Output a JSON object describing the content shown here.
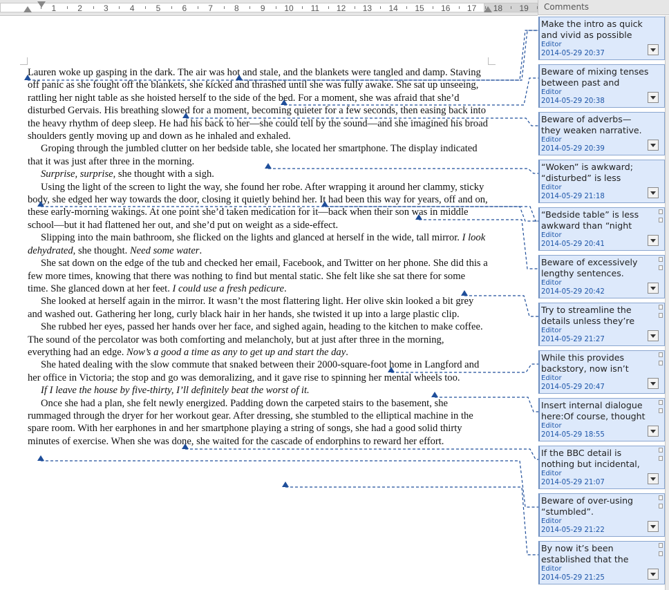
{
  "ruler": {
    "numbers": [
      "1",
      "2",
      "3",
      "4",
      "5",
      "6",
      "7",
      "8",
      "9",
      "10",
      "11",
      "12",
      "13",
      "14",
      "15",
      "16",
      "17",
      "18",
      "19"
    ]
  },
  "comments_panel": {
    "title": "Comments"
  },
  "document": {
    "paragraphs": [
      {
        "indent": false,
        "parts": [
          {
            "t": "Lauren woke up gasping in the dark. The air was hot and stale, and the blankets were tangled and damp. Staving off panic as she fought off the blankets, she kicked and thrashed until she was fully awake. She sat up unseeing, rattling her night table as she hoisted herself to the side of the bed. For a moment, she was afraid that she’d disturbed Gervais. His breathing slowed for a moment, becoming quieter for a few seconds, then easing back into the heavy rhythm of deep sleep. He had his back to her—she could tell by the sound—and she imagined his broad shoulders gently moving up and down as he inhaled and exhaled."
          }
        ]
      },
      {
        "indent": true,
        "parts": [
          {
            "t": "Groping through the jumbled clutter on her bedside table, she located her smartphone. The display indicated that it was just after three in the morning."
          }
        ]
      },
      {
        "indent": true,
        "parts": [
          {
            "t": "Surprise, surprise",
            "i": true
          },
          {
            "t": ", she thought with a sigh."
          }
        ]
      },
      {
        "indent": true,
        "parts": [
          {
            "t": "Using the light of the screen to light the way, she found her robe. After wrapping it around her clammy, sticky body, she edged her way towards the door, closing it quietly behind her. It had been this way for years, off and on, these early-morning wakings. At one point she’d taken medication for it—back when their son was in middle school—but it had flattened her out, and she’d put on weight as a side-effect."
          }
        ]
      },
      {
        "indent": true,
        "parts": [
          {
            "t": "Slipping into the main bathroom, she flicked on the lights and glanced at herself in the wide, tall mirror. "
          },
          {
            "t": "I look dehydrated",
            "i": true
          },
          {
            "t": ", she thought. "
          },
          {
            "t": "Need some water",
            "i": true
          },
          {
            "t": "."
          }
        ]
      },
      {
        "indent": true,
        "parts": [
          {
            "t": "She sat down on the edge of the tub and checked her email, Facebook, and Twitter on her phone. She did this a few more times, knowing that there was nothing to find but mental static. She felt like she sat there for some time. She glanced down at her feet. "
          },
          {
            "t": "I could use a fresh pedicure",
            "i": true
          },
          {
            "t": "."
          }
        ]
      },
      {
        "indent": true,
        "parts": [
          {
            "t": "She looked at herself again in the mirror. It wasn’t the most flattering light. Her olive skin looked a bit grey and washed out. Gathering her long, curly black hair in her hands, she twisted it up into a large plastic clip."
          }
        ]
      },
      {
        "indent": true,
        "parts": [
          {
            "t": "She rubbed her eyes, passed her hands over her face, and sighed again, heading to the kitchen to make coffee. The sound of the percolator was both comforting and melancholy, but at just after three in the morning, everything had an edge. "
          },
          {
            "t": "Now’s a good a time as any to get up and start the day",
            "i": true
          },
          {
            "t": "."
          }
        ]
      },
      {
        "indent": true,
        "parts": [
          {
            "t": "She hated dealing with the slow commute that snaked between their 2000-square-foot home in Langford and her office in Victoria; the stop and go was demoralizing, and it gave rise to spinning her mental wheels too."
          }
        ]
      },
      {
        "indent": true,
        "parts": [
          {
            "t": "If I leave the house by five-thirty, I’ll definitely beat the worst of it.",
            "i": true
          }
        ]
      },
      {
        "indent": true,
        "parts": [
          {
            "t": "Once she had a plan, she felt newly energized. Padding down the carpeted stairs to the basement, she rummaged through the dryer for her workout gear. After dressing, she stumbled to the elliptical machine in the spare room. With her earphones in and her smartphone playing a string of songs, she had a good solid thirty minutes of exercise. When she was done, she waited for the cascade of endorphins to reward her effort."
          }
        ]
      }
    ]
  },
  "comments": [
    {
      "text": "Make the intro as quick and vivid as possible without",
      "author": "Editor",
      "date": "2014-05-29 20:37"
    },
    {
      "text": "Beware of mixing tenses between past and present.",
      "author": "Editor",
      "date": "2014-05-29 20:38"
    },
    {
      "text": "Beware of adverbs—they weaken narrative.",
      "author": "Editor",
      "date": "2014-05-29 20:39"
    },
    {
      "text": "“Woken” is awkward; “disturbed” is less",
      "author": "Editor",
      "date": "2014-05-29 21:18"
    },
    {
      "text": "“Bedside table” is less awkward than “night",
      "author": "Editor",
      "date": "2014-05-29 20:41"
    },
    {
      "text": "Beware of excessively lengthy sentences.",
      "author": "Editor",
      "date": "2014-05-29 20:42"
    },
    {
      "text": "Try to streamline the details unless they’re",
      "author": "Editor",
      "date": "2014-05-29 21:27"
    },
    {
      "text": "While this provides backstory, now isn’t",
      "author": "Editor",
      "date": "2014-05-29 20:47"
    },
    {
      "text": "Insert internal dialogue here:Of course, thought",
      "author": "Editor",
      "date": "2014-05-29 18:55"
    },
    {
      "text": "If the BBC detail is nothing but incidental,",
      "author": "Editor",
      "date": "2014-05-29 21:07"
    },
    {
      "text": "Beware of over-using “stumbled”.",
      "author": "Editor",
      "date": "2014-05-29 21:22"
    },
    {
      "text": "By now it’s been established that the",
      "author": "Editor",
      "date": "2014-05-29 21:25"
    }
  ],
  "colors": {
    "anchor": "#1f4e9a",
    "comment_bg": "#dde9fb",
    "comment_meta": "#1e56a8"
  }
}
